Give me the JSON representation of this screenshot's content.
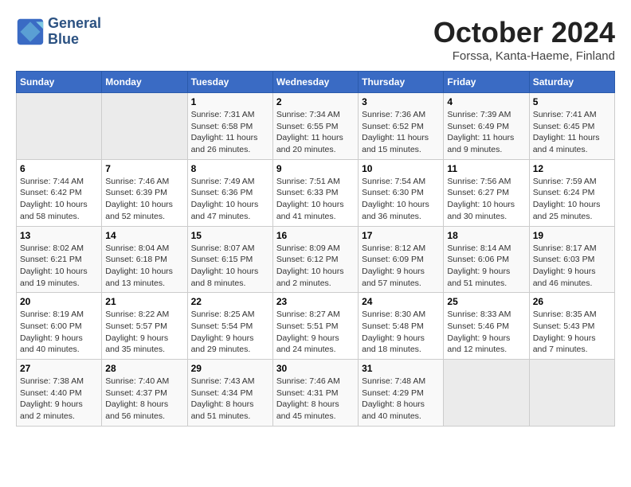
{
  "header": {
    "logo_line1": "General",
    "logo_line2": "Blue",
    "title": "October 2024",
    "subtitle": "Forssa, Kanta-Haeme, Finland"
  },
  "days_of_week": [
    "Sunday",
    "Monday",
    "Tuesday",
    "Wednesday",
    "Thursday",
    "Friday",
    "Saturday"
  ],
  "weeks": [
    [
      {
        "day": "",
        "info": ""
      },
      {
        "day": "",
        "info": ""
      },
      {
        "day": "1",
        "info": "Sunrise: 7:31 AM\nSunset: 6:58 PM\nDaylight: 11 hours\nand 26 minutes."
      },
      {
        "day": "2",
        "info": "Sunrise: 7:34 AM\nSunset: 6:55 PM\nDaylight: 11 hours\nand 20 minutes."
      },
      {
        "day": "3",
        "info": "Sunrise: 7:36 AM\nSunset: 6:52 PM\nDaylight: 11 hours\nand 15 minutes."
      },
      {
        "day": "4",
        "info": "Sunrise: 7:39 AM\nSunset: 6:49 PM\nDaylight: 11 hours\nand 9 minutes."
      },
      {
        "day": "5",
        "info": "Sunrise: 7:41 AM\nSunset: 6:45 PM\nDaylight: 11 hours\nand 4 minutes."
      }
    ],
    [
      {
        "day": "6",
        "info": "Sunrise: 7:44 AM\nSunset: 6:42 PM\nDaylight: 10 hours\nand 58 minutes."
      },
      {
        "day": "7",
        "info": "Sunrise: 7:46 AM\nSunset: 6:39 PM\nDaylight: 10 hours\nand 52 minutes."
      },
      {
        "day": "8",
        "info": "Sunrise: 7:49 AM\nSunset: 6:36 PM\nDaylight: 10 hours\nand 47 minutes."
      },
      {
        "day": "9",
        "info": "Sunrise: 7:51 AM\nSunset: 6:33 PM\nDaylight: 10 hours\nand 41 minutes."
      },
      {
        "day": "10",
        "info": "Sunrise: 7:54 AM\nSunset: 6:30 PM\nDaylight: 10 hours\nand 36 minutes."
      },
      {
        "day": "11",
        "info": "Sunrise: 7:56 AM\nSunset: 6:27 PM\nDaylight: 10 hours\nand 30 minutes."
      },
      {
        "day": "12",
        "info": "Sunrise: 7:59 AM\nSunset: 6:24 PM\nDaylight: 10 hours\nand 25 minutes."
      }
    ],
    [
      {
        "day": "13",
        "info": "Sunrise: 8:02 AM\nSunset: 6:21 PM\nDaylight: 10 hours\nand 19 minutes."
      },
      {
        "day": "14",
        "info": "Sunrise: 8:04 AM\nSunset: 6:18 PM\nDaylight: 10 hours\nand 13 minutes."
      },
      {
        "day": "15",
        "info": "Sunrise: 8:07 AM\nSunset: 6:15 PM\nDaylight: 10 hours\nand 8 minutes."
      },
      {
        "day": "16",
        "info": "Sunrise: 8:09 AM\nSunset: 6:12 PM\nDaylight: 10 hours\nand 2 minutes."
      },
      {
        "day": "17",
        "info": "Sunrise: 8:12 AM\nSunset: 6:09 PM\nDaylight: 9 hours\nand 57 minutes."
      },
      {
        "day": "18",
        "info": "Sunrise: 8:14 AM\nSunset: 6:06 PM\nDaylight: 9 hours\nand 51 minutes."
      },
      {
        "day": "19",
        "info": "Sunrise: 8:17 AM\nSunset: 6:03 PM\nDaylight: 9 hours\nand 46 minutes."
      }
    ],
    [
      {
        "day": "20",
        "info": "Sunrise: 8:19 AM\nSunset: 6:00 PM\nDaylight: 9 hours\nand 40 minutes."
      },
      {
        "day": "21",
        "info": "Sunrise: 8:22 AM\nSunset: 5:57 PM\nDaylight: 9 hours\nand 35 minutes."
      },
      {
        "day": "22",
        "info": "Sunrise: 8:25 AM\nSunset: 5:54 PM\nDaylight: 9 hours\nand 29 minutes."
      },
      {
        "day": "23",
        "info": "Sunrise: 8:27 AM\nSunset: 5:51 PM\nDaylight: 9 hours\nand 24 minutes."
      },
      {
        "day": "24",
        "info": "Sunrise: 8:30 AM\nSunset: 5:48 PM\nDaylight: 9 hours\nand 18 minutes."
      },
      {
        "day": "25",
        "info": "Sunrise: 8:33 AM\nSunset: 5:46 PM\nDaylight: 9 hours\nand 12 minutes."
      },
      {
        "day": "26",
        "info": "Sunrise: 8:35 AM\nSunset: 5:43 PM\nDaylight: 9 hours\nand 7 minutes."
      }
    ],
    [
      {
        "day": "27",
        "info": "Sunrise: 7:38 AM\nSunset: 4:40 PM\nDaylight: 9 hours\nand 2 minutes."
      },
      {
        "day": "28",
        "info": "Sunrise: 7:40 AM\nSunset: 4:37 PM\nDaylight: 8 hours\nand 56 minutes."
      },
      {
        "day": "29",
        "info": "Sunrise: 7:43 AM\nSunset: 4:34 PM\nDaylight: 8 hours\nand 51 minutes."
      },
      {
        "day": "30",
        "info": "Sunrise: 7:46 AM\nSunset: 4:31 PM\nDaylight: 8 hours\nand 45 minutes."
      },
      {
        "day": "31",
        "info": "Sunrise: 7:48 AM\nSunset: 4:29 PM\nDaylight: 8 hours\nand 40 minutes."
      },
      {
        "day": "",
        "info": ""
      },
      {
        "day": "",
        "info": ""
      }
    ]
  ]
}
